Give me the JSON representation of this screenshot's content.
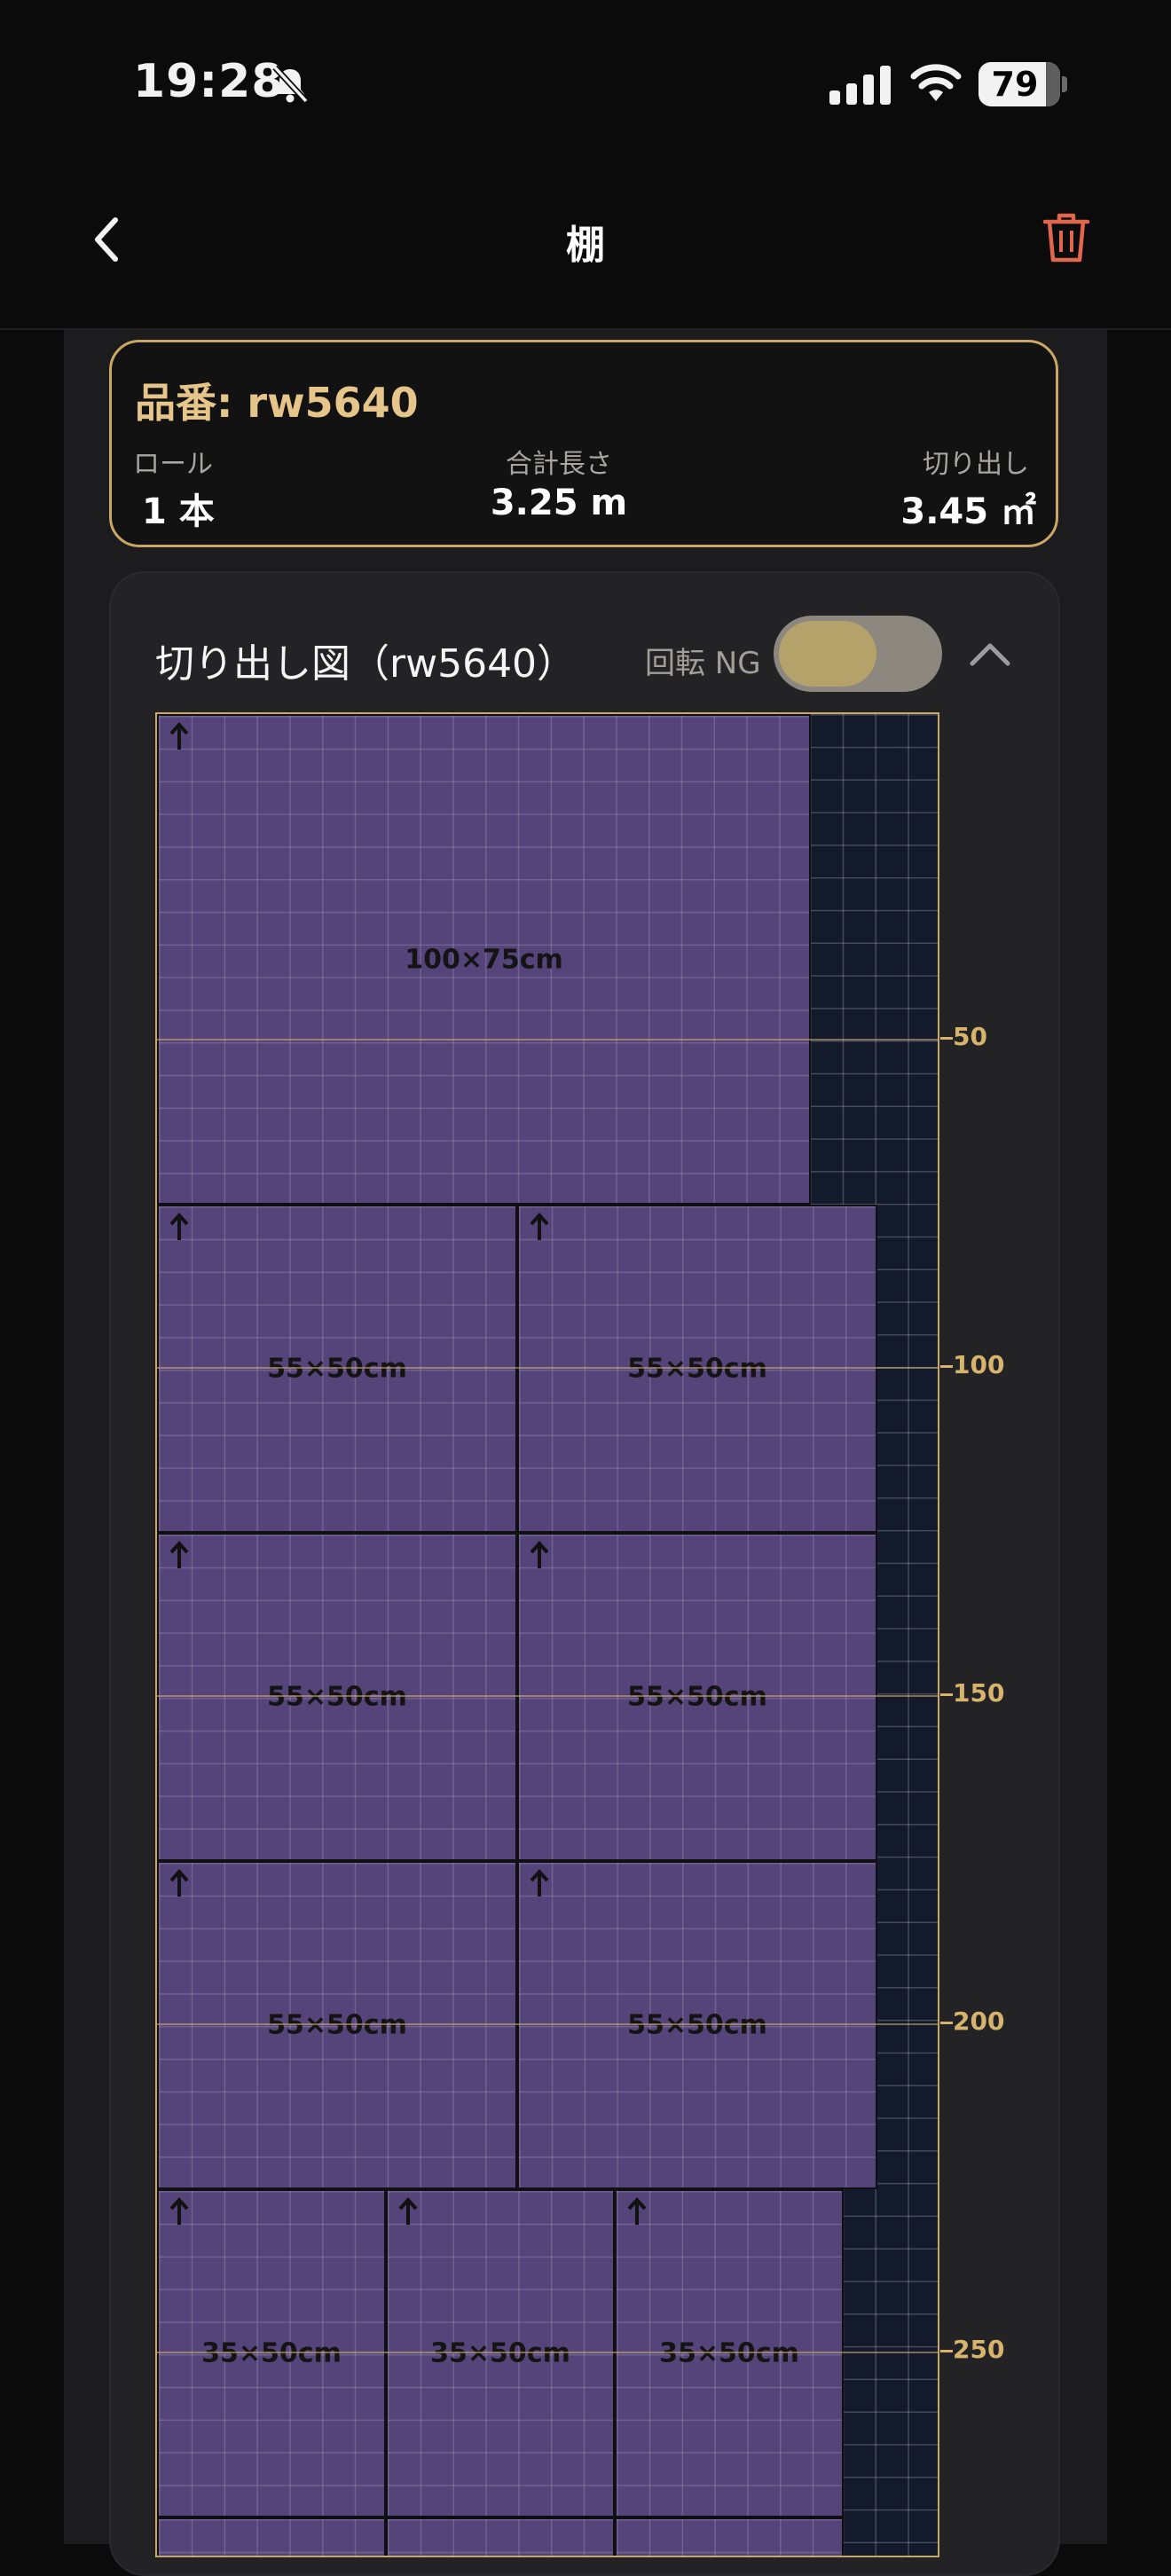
{
  "status_bar": {
    "time": "19:28",
    "battery": "79"
  },
  "nav": {
    "title": "棚"
  },
  "summary": {
    "title": "品番: rw5640",
    "roll_label": "ロール",
    "roll_value": "1 本",
    "total_label": "合計長さ",
    "total_value": "3.25 m",
    "cut_label": "切り出し",
    "cut_value": "3.45 ㎡"
  },
  "diagram": {
    "title": "切り出し図（rw5640）",
    "rotate_label": "回転 NG",
    "rotate_enabled": false,
    "pieces": [
      "100×75cm",
      "55×50cm",
      "55×50cm",
      "55×50cm",
      "55×50cm",
      "55×50cm",
      "55×50cm",
      "35×50cm",
      "35×50cm",
      "35×50cm"
    ],
    "ruler": [
      "50",
      "100",
      "150",
      "200",
      "250"
    ]
  },
  "colors": {
    "accent": "#c9a865",
    "piece": "#54447a",
    "roll": "#121a2b",
    "danger": "#e0674e"
  },
  "icons": [
    "bell-slash-icon",
    "cellular-signal-icon",
    "wifi-icon",
    "battery-icon",
    "chevron-left-icon",
    "trash-icon",
    "chevron-up-icon",
    "arrow-up-icon"
  ]
}
